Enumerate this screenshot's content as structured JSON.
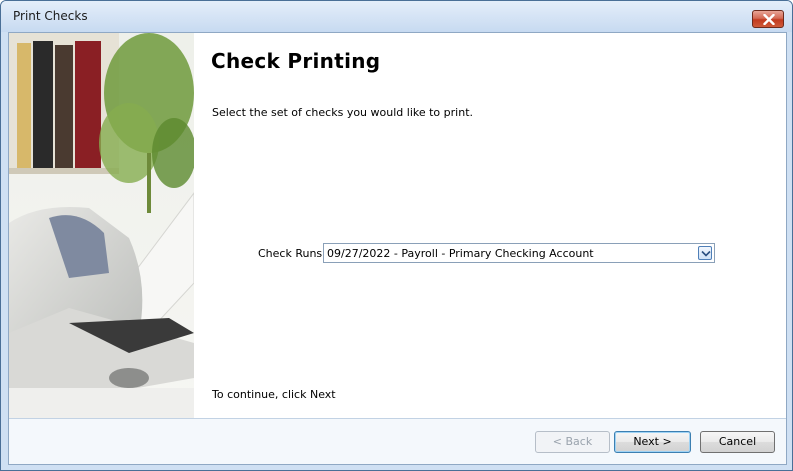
{
  "window": {
    "title": "Print Checks"
  },
  "main": {
    "heading": "Check Printing",
    "instruction": "Select the set of checks you would like to print.",
    "check_runs": {
      "label": "Check Runs",
      "selected": "09/27/2022 - Payroll - Primary Checking Account"
    },
    "footer_hint": "To continue, click Next"
  },
  "buttons": {
    "back": "< Back",
    "next": "Next >",
    "cancel": "Cancel"
  },
  "icons": {
    "close": "close-icon",
    "dropdown": "chevron-down-icon",
    "side": "printer-illustration"
  },
  "colors": {
    "titlebar": "#d4e3f5",
    "close_button": "#c23a1f",
    "focus_border": "#3c7fb1"
  }
}
